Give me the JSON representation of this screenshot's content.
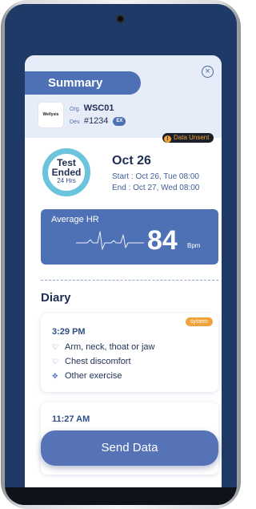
{
  "header": {
    "title": "Summary",
    "close_icon": "close-icon"
  },
  "org": {
    "logo_text": "Wellysis",
    "org_label": "Org.",
    "org_value": "WSC01",
    "dev_label": "Dev.",
    "dev_value": "#1234",
    "ex_badge": "EX",
    "unsent_icon": "!",
    "unsent_text": "Data Unsent"
  },
  "test": {
    "status_line1": "Test",
    "status_line2": "Ended",
    "duration": "24 Hrs",
    "date": "Oct 26",
    "start": "Start : Oct 26, Tue 08:00",
    "end": "End : Oct 27, Wed 08:00"
  },
  "hr": {
    "label": "Average HR",
    "value": "84",
    "unit": "Bpm"
  },
  "diary": {
    "title": "Diary",
    "entries": [
      {
        "time": "3:29 PM",
        "badge": "system",
        "items": [
          {
            "icon": "heart-icon",
            "text": "Arm, neck, thoat or jaw"
          },
          {
            "icon": "heart-icon",
            "text": "Chest discomfort"
          },
          {
            "icon": "running-icon",
            "text": "Other exercise"
          }
        ]
      },
      {
        "time": "11:27 AM"
      }
    ]
  },
  "actions": {
    "send_label": "Send Data"
  },
  "colors": {
    "primary": "#4e70b4",
    "ring": "#6cc4dc",
    "warning": "#f2a23a",
    "header_bg": "#e6edf8"
  }
}
